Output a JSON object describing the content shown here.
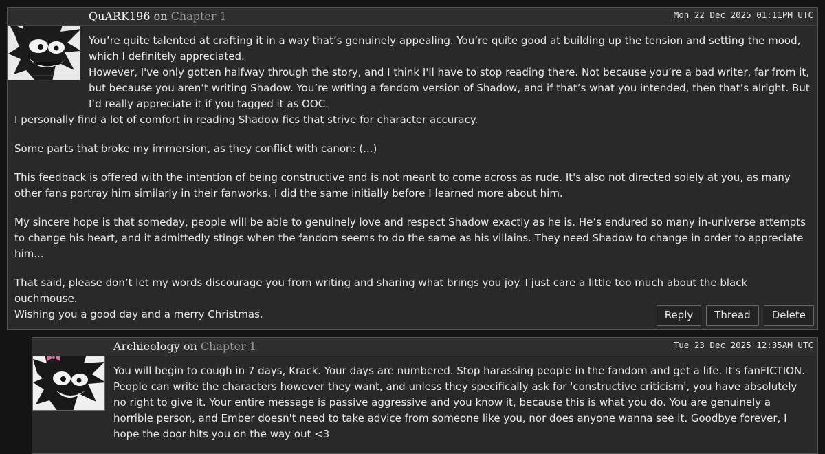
{
  "comments": [
    {
      "author": "QuARK196",
      "on": "on",
      "chapter": "Chapter 1",
      "date": {
        "day": "Mon",
        "dd": "22",
        "month": "Dec",
        "year": "2025",
        "time": "01:11PM",
        "tz": "UTC"
      },
      "avatar_icon": "manga-hedgehog-avatar",
      "paragraphs": [
        "You’re quite talented at crafting it in a way that’s genuinely appealing. You’re quite good at building up the tension and setting the mood, which I definitely appreciated.",
        "However, I've only gotten halfway through the story, and I think I'll have to stop reading there. Not because you’re a bad writer, far from it, but because you aren’t writing Shadow. You’re writing a fandom version of Shadow, and if that’s what you intended, then that’s alright. But I’d really appreciate it if you tagged it as OOC.",
        "I personally find a lot of comfort in reading Shadow fics that strive for character accuracy.",
        "Some parts that broke my immersion, as they conflict with canon: (...)",
        "This feedback is offered with the intention of being constructive and is not meant to come across as rude. It's also not directed solely at you, as many other fans portray him similarly in their fanworks. I did the same initially before I learned more about him.",
        "My sincere hope is that someday, people will be able to genuinely love and respect Shadow exactly as he is. He’s endured so many in-universe attempts to change his heart, and it admittedly stings when the fandom seems to do the same as his villains. They need Shadow to change in order to appreciate him...",
        "That said, please don’t let my words discourage you from writing and sharing what brings you joy. I just care a little too much about the black ouchmouse.",
        "Wishing you a good day and a merry Christmas."
      ],
      "actions": [
        "Reply",
        "Thread",
        "Delete"
      ]
    },
    {
      "author": "Archieology",
      "on": "on",
      "chapter": "Chapter 1",
      "date": {
        "day": "Tue",
        "dd": "23",
        "month": "Dec",
        "year": "2025",
        "time": "12:35AM",
        "tz": "UTC"
      },
      "avatar_icon": "manga-hedgehog-bows-avatar",
      "paragraphs": [
        "You will begin to cough in 7 days, Krack. Your days are numbered. Stop harassing people in the fandom and get a life. It's fanFICTION. People can write the characters however they want, and unless they specifically ask for 'constructive criticism', you have absolutely no right to give it. Your entire message is passive aggressive and you know it, because this is what you do. You are genuinely a horrible person, and Ember doesn't need to take advice from someone like you, nor does anyone wanna see it. Goodbye forever, I hope the door hits you on the way out <3"
      ]
    }
  ]
}
